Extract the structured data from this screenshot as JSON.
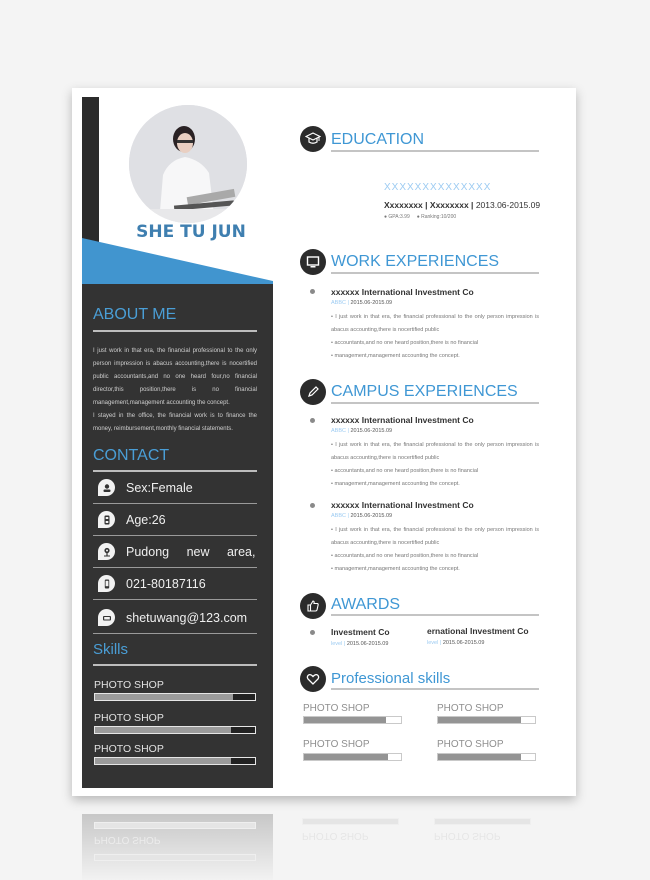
{
  "profile": {
    "name": "SHE TU JUN",
    "photo_icon": "portrait-photo"
  },
  "about": {
    "heading": "ABOUT ME",
    "paragraphs": [
      "I just work in that era, the financial professional to the only person impression is abacus accounting,there is nocertified public accountants,and no one heard four,no financial director,this position,there is no financial management,management accounting the concept.",
      "I stayed in the office, the financial work is to finance the money, reimbursement,monthly financial statements."
    ]
  },
  "contact": {
    "heading": "CONTACT",
    "items": [
      {
        "icon": "person-icon",
        "text": "Sex:Female"
      },
      {
        "icon": "hourglass-icon",
        "text": "Age:26"
      },
      {
        "icon": "location-pin-icon",
        "text": "Pudong new area,"
      },
      {
        "icon": "phone-icon",
        "text": "021-80187116"
      },
      {
        "icon": "email-icon",
        "text": "shetuwang@123.com"
      }
    ]
  },
  "skills": {
    "heading": "Skills",
    "items": [
      {
        "label": "PHOTO SHOP",
        "level": 0.86
      },
      {
        "label": "PHOTO SHOP",
        "level": 0.85
      },
      {
        "label": "PHOTO SHOP",
        "level": 0.85
      }
    ]
  },
  "education": {
    "heading": "EDUCATION",
    "icon": "graduation-cap-icon",
    "school": "XXXXXXXXXXXXXX",
    "major": "Xxxxxxxx",
    "degree": "Xxxxxxxx",
    "sep": "|",
    "period": "2013.06-2015.09",
    "gpa": "GPA:3.99",
    "ranking": "Ranking:10/200"
  },
  "work": {
    "heading": "WORK EXPERIENCES",
    "icon": "monitor-icon",
    "items": [
      {
        "company": "xxxxxx International Investment Co",
        "level": "ABBC",
        "sep": "|",
        "period": "2015.06-2015.09",
        "lines": [
          "• I just work in that era, the financial professional to the only person impression is abacus accounting,there is nocertified public",
          "• accountants,and no one heard position,there is no financial",
          "• management,management accounting the concept."
        ]
      }
    ]
  },
  "campus": {
    "heading": "CAMPUS EXPERIENCES",
    "icon": "pencil-icon",
    "items": [
      {
        "company": "xxxxxx International Investment Co",
        "level": "ABBC",
        "sep": "|",
        "period": "2015.06-2015.09",
        "lines": [
          "• I just work in that era, the financial professional to the only person impression is abacus accounting,there is nocertified public",
          "• accountants,and no one heard position,there is no financial",
          "• management,management accounting the concept."
        ]
      },
      {
        "company": "xxxxxx International Investment Co",
        "level": "ABBC",
        "sep": "|",
        "period": "2015.06-2015.09",
        "lines": [
          "• I just work in that era, the financial professional to the only person impression is abacus accounting,there is nocertified public",
          "• accountants,and no one heard position,there is no financial",
          "• management,management accounting the concept."
        ]
      }
    ]
  },
  "awards": {
    "heading": "AWARDS",
    "icon": "thumbs-up-icon",
    "items": [
      {
        "title": "Investment Co",
        "level": "level",
        "sep": "|",
        "period": "2015.06-2015.09"
      },
      {
        "title": "ernational Investment Co",
        "level": "level",
        "sep": "|",
        "period": "2015.06-2015.09"
      }
    ]
  },
  "professional_skills": {
    "heading": "Professional skills",
    "icon": "heart-icon",
    "items": [
      {
        "label": "PHOTO SHOP",
        "level": 0.85
      },
      {
        "label": "PHOTO SHOP",
        "level": 0.86
      },
      {
        "label": "PHOTO SHOP",
        "level": 0.87
      },
      {
        "label": "PHOTO SHOP",
        "level": 0.86
      }
    ]
  },
  "reflection": {
    "labels": [
      "PHOTO SHOP",
      "PHOTO SHOP",
      "PHOTO SHOP"
    ]
  },
  "colors": {
    "accent": "#3f97d4",
    "name": "#3f7fb0",
    "sidebar": "#333333",
    "blue_band": "#4195cf"
  }
}
